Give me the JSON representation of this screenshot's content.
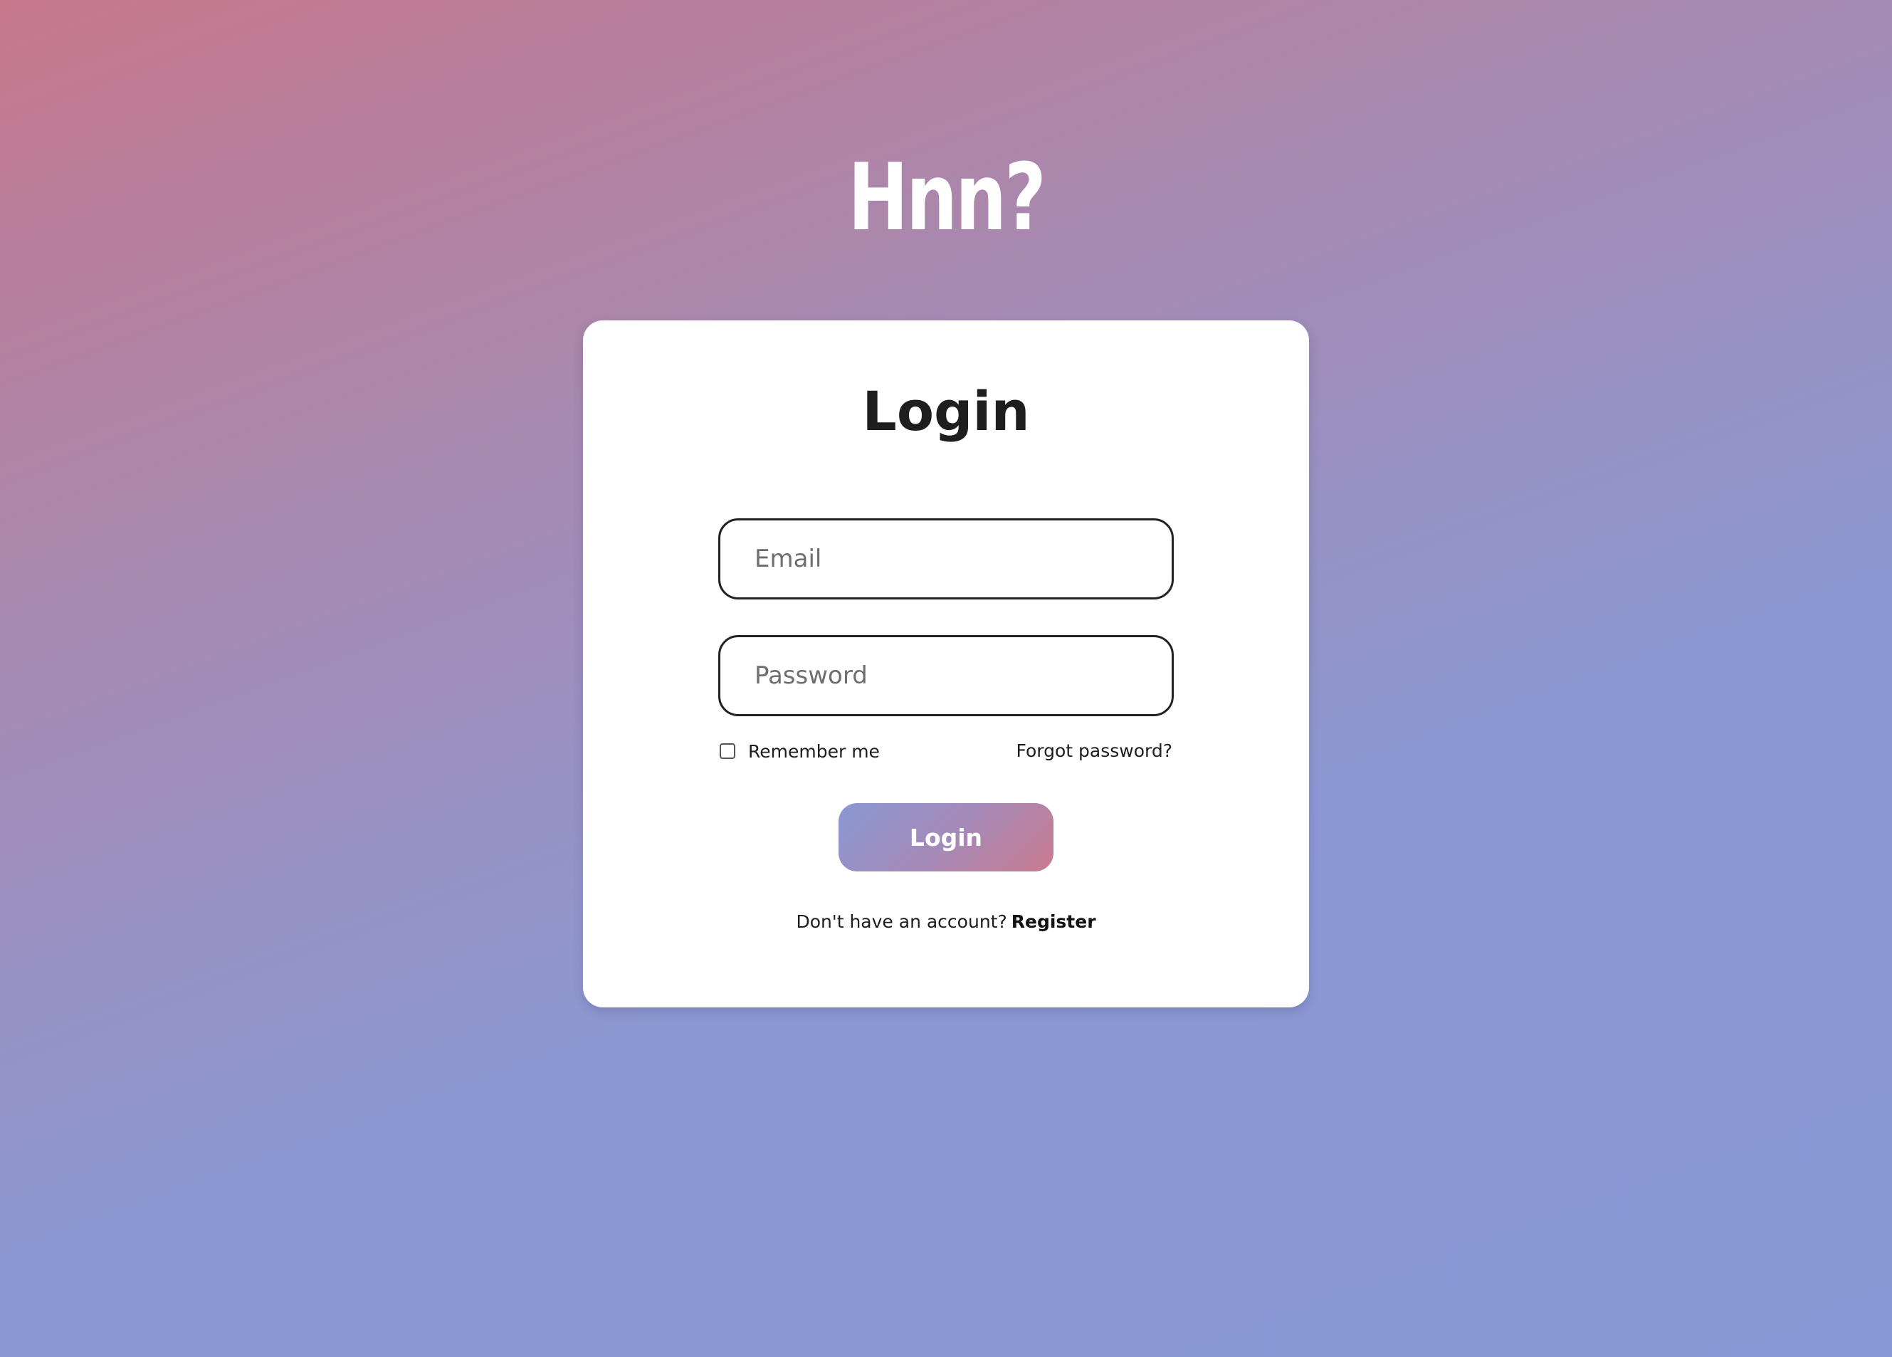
{
  "brand": {
    "logo_text": "Hnn?"
  },
  "login_card": {
    "title": "Login",
    "email": {
      "placeholder": "Email",
      "value": ""
    },
    "password": {
      "placeholder": "Password",
      "value": ""
    },
    "remember_me": {
      "label": "Remember me",
      "checked": false
    },
    "forgot_password_label": "Forgot password?",
    "submit_label": "Login",
    "register_prompt": "Don't have an account?",
    "register_label": "Register"
  },
  "colors": {
    "background_gradient": [
      "#c6788c",
      "#8799d4"
    ],
    "button_gradient": [
      "#8a98d4",
      "#c97b8f"
    ],
    "card": "#ffffff",
    "text": "#1e1e1e"
  }
}
